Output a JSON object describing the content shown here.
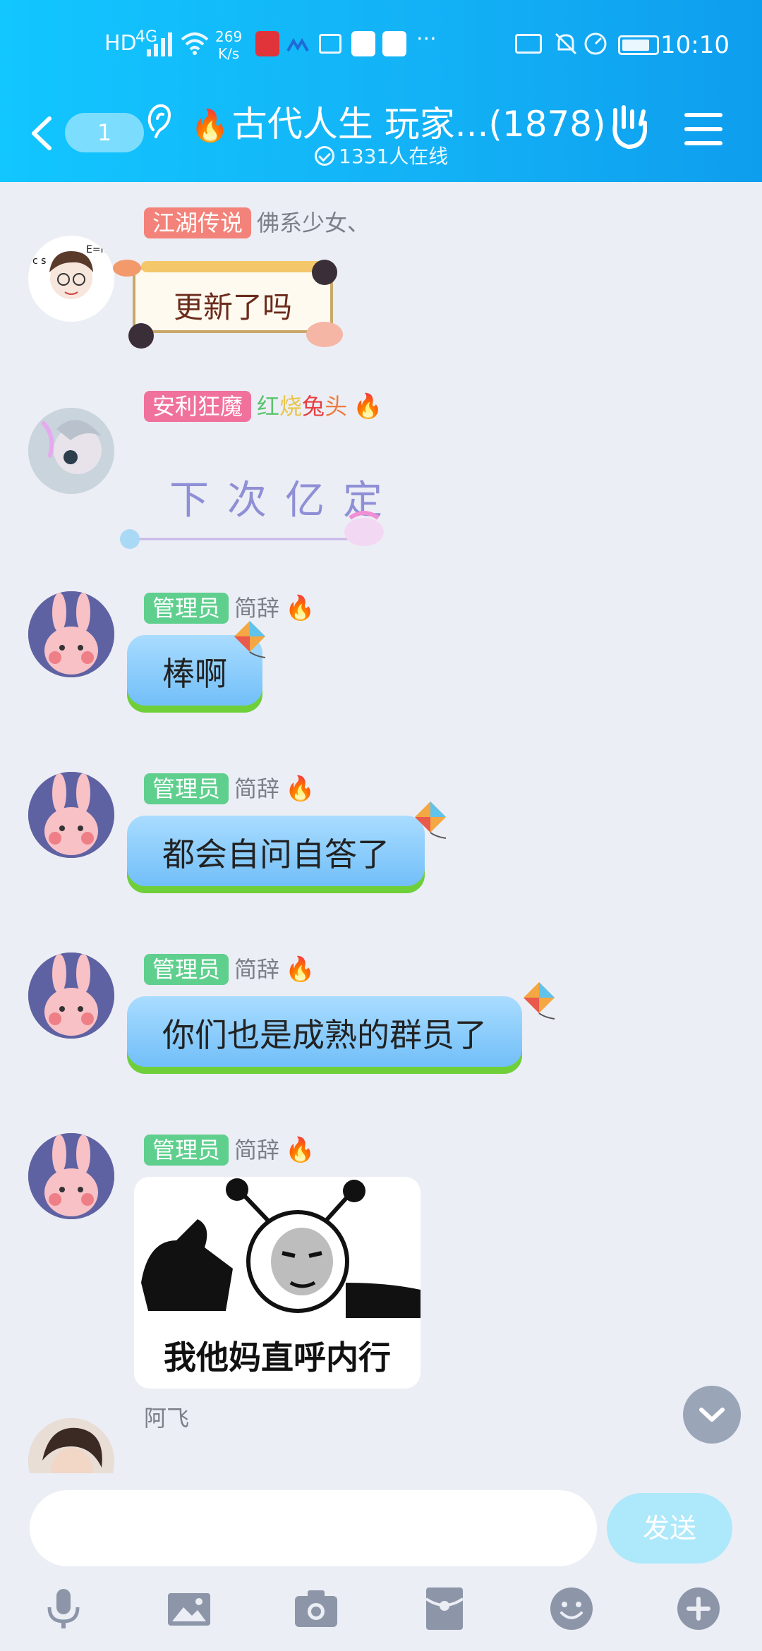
{
  "status_bar": {
    "network": "4G",
    "speed_value": "269",
    "speed_unit": "K/s",
    "time": "10:10"
  },
  "header": {
    "unread_count": "1",
    "title": "古代人生 玩家...(1878)",
    "online_text": "1331人在线"
  },
  "messages": [
    {
      "tag": "江湖传说",
      "name": "佛系少女、",
      "kind": "sticker_text",
      "content": "更新了吗"
    },
    {
      "tag": "安利狂魔",
      "name_parts": [
        "红",
        "烧",
        "兔",
        "头"
      ],
      "kind": "handwriting",
      "content": "下次亿定"
    },
    {
      "tag": "管理员",
      "name": "简辞",
      "kind": "text",
      "content": "棒啊"
    },
    {
      "tag": "管理员",
      "name": "简辞",
      "kind": "text",
      "content": "都会自问自答了"
    },
    {
      "tag": "管理员",
      "name": "简辞",
      "kind": "text",
      "content": "你们也是成熟的群员了"
    },
    {
      "tag": "管理员",
      "name": "简辞",
      "kind": "image",
      "content": "我他妈直呼内行"
    },
    {
      "name": "阿飞"
    }
  ],
  "input": {
    "placeholder": "",
    "send_label": "发送"
  },
  "colors": {
    "header_gradient_start": "#12c6ff",
    "header_gradient_end": "#0e9eee",
    "chat_background": "#eceef5",
    "tag_red": "#f3837a",
    "tag_pink": "#f0729c",
    "tag_green": "#5fcf8e",
    "bubble_blue": "#6cbcf8",
    "send_disabled": "#aee8fb"
  },
  "toolbar_icons": [
    "microphone-icon",
    "image-icon",
    "camera-icon",
    "red-packet-icon",
    "emoji-icon",
    "plus-icon"
  ]
}
